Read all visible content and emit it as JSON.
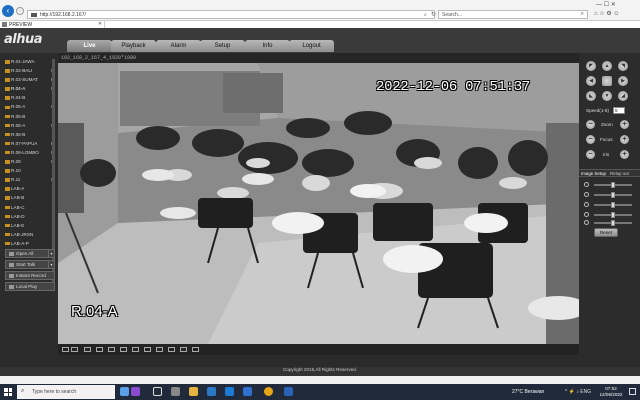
{
  "browser": {
    "url": "http://192.168.2.167/",
    "search_placeholder": "Search...",
    "tab_title": "PREVIEW",
    "window_controls": "—   ☐   ✕",
    "browser_icons": "⌂ ☆ ⚙ ☺"
  },
  "app": {
    "logo": "alhua",
    "nav": [
      "Live",
      "Playback",
      "Alarm",
      "Setup",
      "Info",
      "Logout"
    ],
    "active_nav": "Live"
  },
  "channels": [
    {
      "name": "R.01-JAWA",
      "m": ""
    },
    {
      "name": "R.02-BALI",
      "m": "M"
    },
    {
      "name": "R.03-SUMAT",
      "m": "M"
    },
    {
      "name": "R.04-A",
      "m": "M"
    },
    {
      "name": "R.04-B",
      "m": ""
    },
    {
      "name": "R.05-A",
      "m": "M"
    },
    {
      "name": "R.05-B",
      "m": ""
    },
    {
      "name": "R.06-A",
      "m": "M"
    },
    {
      "name": "R.06-B",
      "m": ""
    },
    {
      "name": "R.07-PAPUA",
      "m": "M"
    },
    {
      "name": "R.08-LOMBO",
      "m": "M"
    },
    {
      "name": "R.09",
      "m": "M"
    },
    {
      "name": "R.10",
      "m": ""
    },
    {
      "name": "R.11",
      "m": "M"
    },
    {
      "name": "LAB-A",
      "m": ""
    },
    {
      "name": "LAB-B",
      "m": ""
    },
    {
      "name": "LAB-C",
      "m": ""
    },
    {
      "name": "LAB-D",
      "m": ""
    },
    {
      "name": "LAB-E",
      "m": ""
    },
    {
      "name": "LAB-JRSN",
      "m": ""
    },
    {
      "name": "LAB-A-P",
      "m": ""
    }
  ],
  "side_buttons": {
    "open_all": "Open All",
    "start_talk": "Start Talk",
    "instant_record": "Instant Record",
    "local_play": "Local Play"
  },
  "video": {
    "stream_info": "192_168_2_167_4_1920*1080",
    "timestamp": "2022-12-06 07:51:37",
    "channel_name": "R.04-A"
  },
  "ptz": {
    "speed_label": "Speed(1-8)",
    "speed_value": "5",
    "zoom_label": "Zoom",
    "focus_label": "Focus",
    "iris_label": "Iris"
  },
  "image_setup": {
    "tab_image": "Image Setup",
    "tab_relay": "Relay-out",
    "reset_label": "Reset",
    "levels": [
      0.5,
      0.5,
      0.5,
      0.5,
      0.5
    ]
  },
  "footer": {
    "copyright": "Copyright 2015,All Rights Reserved."
  },
  "taskbar": {
    "search_placeholder": "Type here to search",
    "weather": "27°C  Berawan",
    "time": "07:52",
    "date": "12/06/2022",
    "tray": "^  ⚡  ♪  ENG"
  }
}
